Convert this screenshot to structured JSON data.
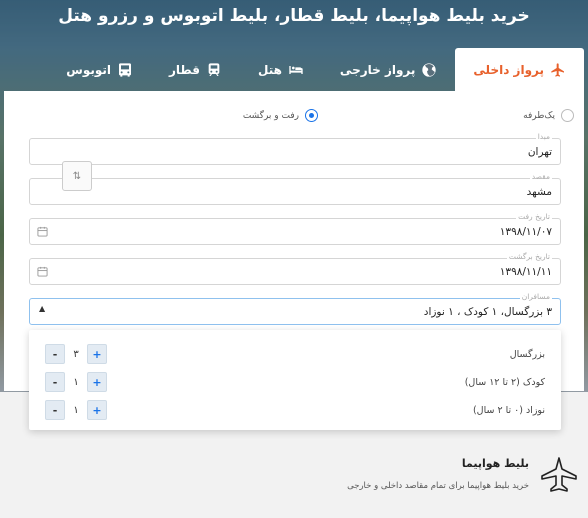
{
  "headline": "خرید بلیط هواپیما، بلیط قطار، بلیط اتوبوس و رزرو هتل",
  "tabs": [
    {
      "label": "پرواز داخلی",
      "icon": "airplane-icon",
      "active": true
    },
    {
      "label": "پرواز خارجی",
      "icon": "globe-icon",
      "active": false
    },
    {
      "label": "هتل",
      "icon": "bed-icon",
      "active": false
    },
    {
      "label": "قطار",
      "icon": "train-icon",
      "active": false
    },
    {
      "label": "اتوبوس",
      "icon": "bus-icon",
      "active": false
    }
  ],
  "colors": {
    "accent": "#e8612c",
    "radio": "#1a73e8",
    "plus": "#1a73e8"
  },
  "trip_type": {
    "one_way": "یک‌طرفه",
    "round_trip": "رفت و برگشت",
    "selected": "round_trip"
  },
  "form": {
    "origin": {
      "label": "مبدا",
      "value": "تهران"
    },
    "destination": {
      "label": "مقصد",
      "value": "مشهد"
    },
    "swap_icon": "⇅",
    "depart": {
      "label": "تاریخ رفت",
      "value": "۱۳۹۸/۱۱/۰۷"
    },
    "return": {
      "label": "تاریخ برگشت",
      "value": "۱۳۹۸/۱۱/۱۱"
    },
    "passengers": {
      "label": "مسافران",
      "value": "۳ بزرگسال، ۱ کودک ، ۱ نوزاد"
    }
  },
  "passenger_rows": [
    {
      "label": "بزرگسال",
      "count": "۳"
    },
    {
      "label": "کودک (۲ تا ۱۲ سال)",
      "count": "۱"
    },
    {
      "label": "نوزاد (۰ تا ۲ سال)",
      "count": "۱"
    }
  ],
  "stepper": {
    "plus": "+",
    "minus": "-"
  },
  "feature": {
    "title": "بلیط هواپیما",
    "description": "خرید بلیط هواپیما برای تمام مقاصد داخلی و خارجی",
    "icon": "airplane-outline-icon"
  }
}
